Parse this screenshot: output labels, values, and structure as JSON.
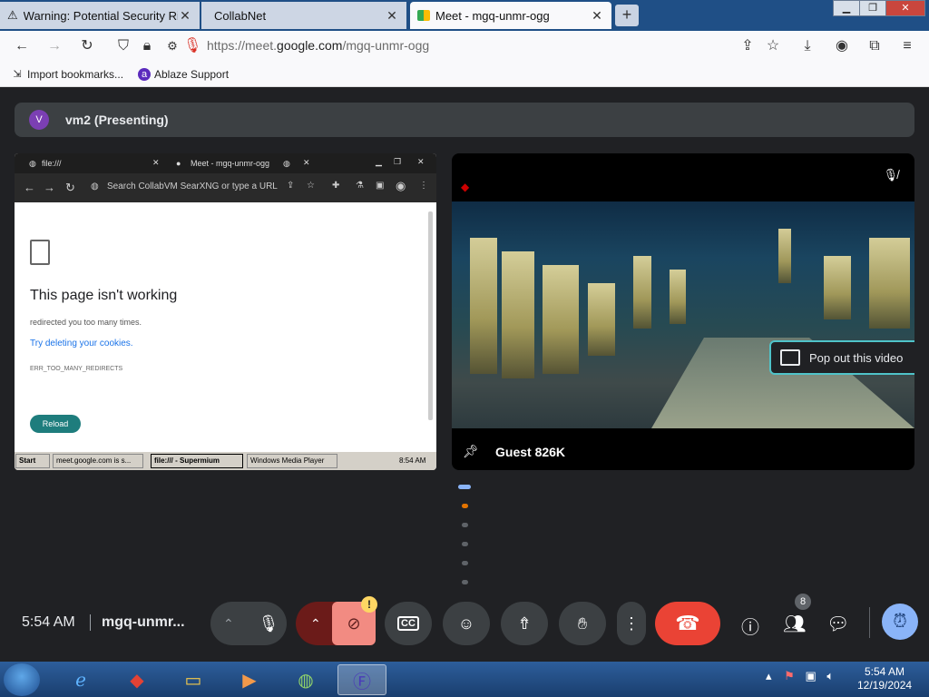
{
  "browser": {
    "tabs": [
      {
        "label": "Warning: Potential Security Risk",
        "icon": "warning-icon"
      },
      {
        "label": "CollabNet",
        "icon": ""
      },
      {
        "label": "Meet - mgq-unmr-ogg",
        "icon": "meet-icon"
      }
    ],
    "url_prefix": "https://meet.",
    "url_domain": "google.com",
    "url_path": "/mgq-unmr-ogg",
    "bookmarks": [
      {
        "label": "Import bookmarks...",
        "icon": "import-icon"
      },
      {
        "label": "Ablaze Support",
        "icon": "ablaze-icon"
      }
    ]
  },
  "meet": {
    "presenter_avatar": "V",
    "presenter_label": "vm2 (Presenting)",
    "shared_screen": {
      "tab1": "file:///",
      "tab2": "Meet - mgq-unmr-ogg",
      "omnibox": "Search CollabVM SearXNG or type a URL",
      "heading": "This page isn't working",
      "message": "redirected you too many times.",
      "suggestion": "Try deleting your cookies.",
      "error_code": "ERR_TOO_MANY_REDIRECTS",
      "reload": "Reload",
      "taskbar": {
        "start": "Start",
        "items": [
          "meet.google.com is s...",
          "file:/// - Supermium",
          "Windows Media Player"
        ],
        "time": "8:54 AM"
      }
    },
    "guest_name": "Guest 826K",
    "popout_label": "Pop out this video",
    "controls": {
      "time": "5:54 AM",
      "meeting_code": "mgq-unmr...",
      "participants_count": "8",
      "warn_badge": "!"
    }
  },
  "windows": {
    "time": "5:54 AM",
    "date": "12/19/2024"
  },
  "colors": {
    "meet_bg": "#202124",
    "hangup": "#ea4335",
    "accent": "#8ab4f8"
  }
}
